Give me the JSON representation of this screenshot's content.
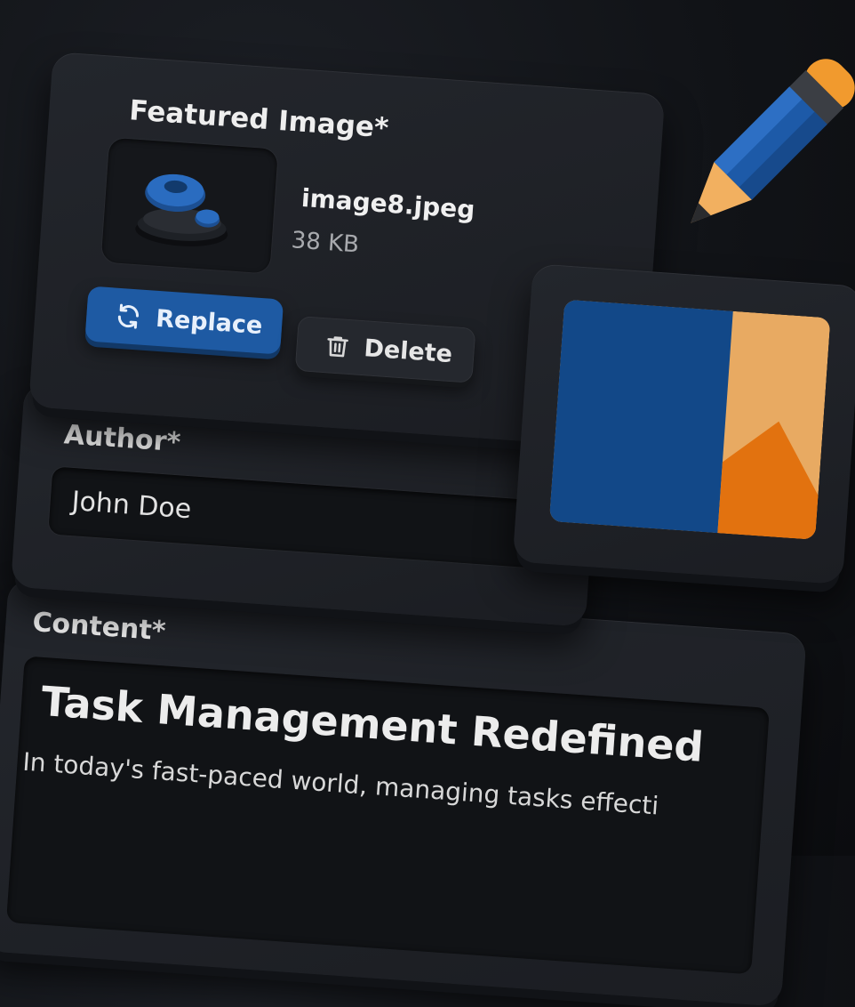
{
  "featured_image": {
    "label": "Featured Image*",
    "file_name": "image8.jpeg",
    "file_size": "38 KB",
    "replace_label": "Replace",
    "delete_label": "Delete",
    "replace_icon": "refresh-icon",
    "delete_icon": "trash-icon"
  },
  "author": {
    "label": "Author*",
    "value": "John Doe"
  },
  "content": {
    "label": "Content*",
    "title": "Task Management Redefined",
    "body": "In today's fast-paced world, managing tasks effecti"
  },
  "decor": {
    "pencil_icon": "pencil-icon",
    "preview_icon": "image-placeholder-icon"
  },
  "colors": {
    "accent_blue": "#1e5aa3",
    "preview_blue": "#124888",
    "preview_light_orange": "#e8aa62",
    "preview_orange": "#e2720f",
    "background": "#111317"
  }
}
